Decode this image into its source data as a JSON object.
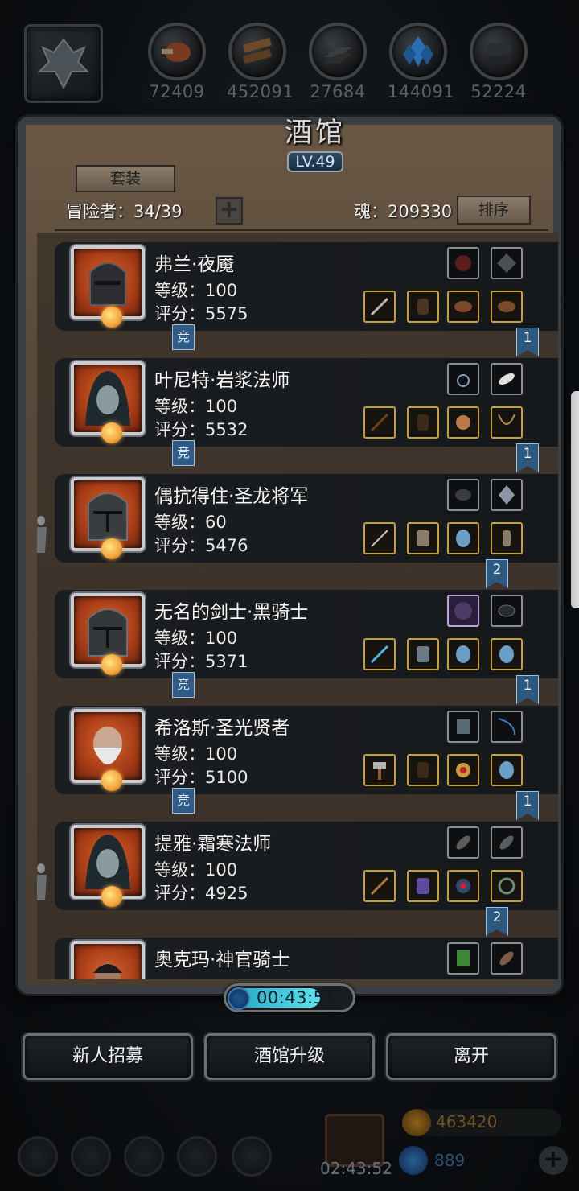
{
  "resources": [
    {
      "icon": "meat-icon",
      "count": "72409"
    },
    {
      "icon": "wood-icon",
      "count": "452091"
    },
    {
      "icon": "iron-icon",
      "count": "27684"
    },
    {
      "icon": "crystal-icon",
      "count": "144091"
    },
    {
      "icon": "stone-icon",
      "count": "52224"
    }
  ],
  "panel": {
    "title": "酒馆",
    "level": "LV.49",
    "set_button": "套装",
    "adventurers": "冒险者：34/39",
    "soul": "魂：209330",
    "sort_button": "排序"
  },
  "heroes": [
    {
      "name": "弗兰·夜魇",
      "level": "等级：100",
      "score": "评分：5575",
      "tag_left": "竞",
      "tag_right": "1"
    },
    {
      "name": "叶尼特·岩浆法师",
      "level": "等级：100",
      "score": "评分：5532",
      "tag_left": "竞",
      "tag_right": "1"
    },
    {
      "name": "偶抗得住·圣龙将军",
      "level": "等级：60",
      "score": "评分：5476",
      "tag_left": "",
      "tag_right": "2"
    },
    {
      "name": "无名的剑士·黑骑士",
      "level": "等级：100",
      "score": "评分：5371",
      "tag_left": "竞",
      "tag_right": "1"
    },
    {
      "name": "希洛斯·圣光贤者",
      "level": "等级：100",
      "score": "评分：5100",
      "tag_left": "竞",
      "tag_right": "1"
    },
    {
      "name": "提雅·霜寒法师",
      "level": "等级：100",
      "score": "评分：4925",
      "tag_left": "",
      "tag_right": "2"
    },
    {
      "name": "奥克玛·神官骑士",
      "level": "",
      "score": "",
      "tag_left": "",
      "tag_right": ""
    }
  ],
  "timer": {
    "value": "00:43:51",
    "progress": 0.72
  },
  "buttons": {
    "recruit": "新人招募",
    "upgrade": "酒馆升级",
    "leave": "离开"
  },
  "hud": {
    "chest_timer": "02:43:52",
    "gold": "463420",
    "gems": "889"
  },
  "colors": {
    "gold_border": "#c7a03a",
    "tag_blue": "#2d5880",
    "panel_bg": "#41362c"
  }
}
